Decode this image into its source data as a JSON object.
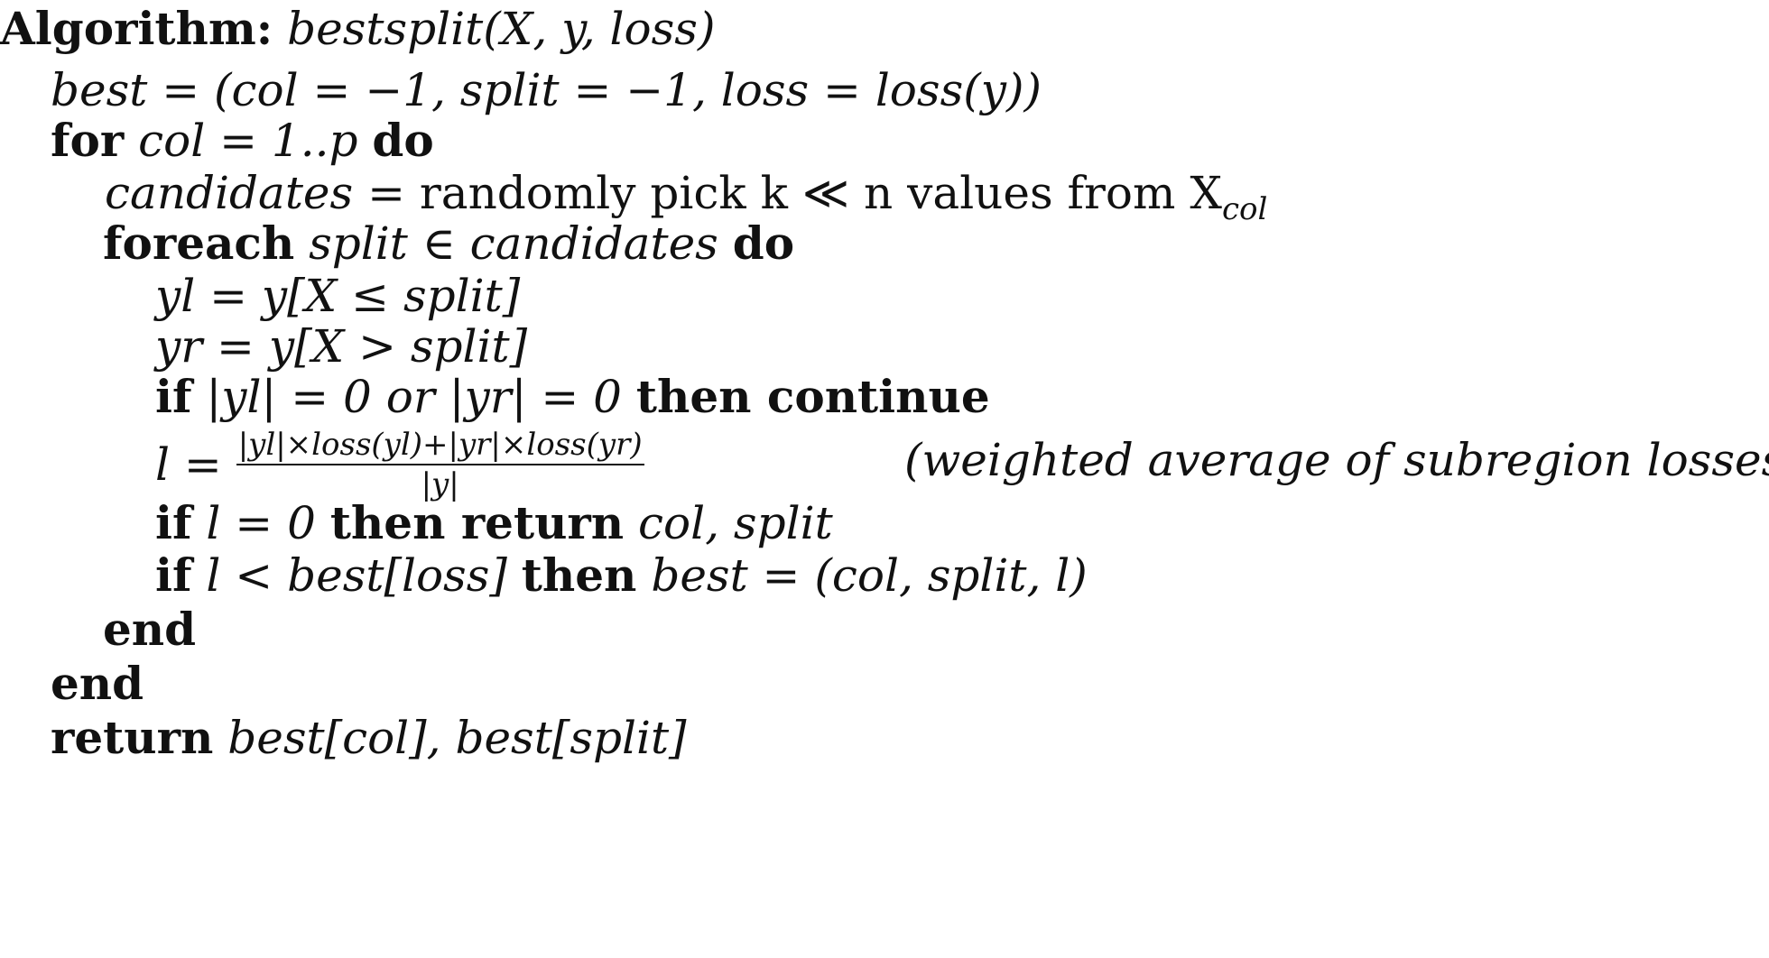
{
  "algorithm": {
    "header_keyword": "Algorithm:",
    "header_signature": "bestsplit(X, y, loss)",
    "lines": {
      "init": "best = (col = −1, split = −1, loss = loss(y))",
      "for_kw": "for",
      "for_expr": "col = 1..p",
      "for_do": "do",
      "candidates_lhs": "candidates",
      "candidates_rhs": " = randomly pick k ≪ n values from X",
      "candidates_sub": "col",
      "foreach_kw": "foreach",
      "foreach_expr": "split ∈ candidates",
      "foreach_do": "do",
      "yl": "yl = y[X ≤ split]",
      "yr": "yr = y[X > split]",
      "if1_kw": "if",
      "if1_expr": "|yl| = 0  or  |yr| = 0",
      "if1_then": "then continue",
      "l_lhs": "l = ",
      "l_numerator": "|yl|×loss(yl)+|yr|×loss(yr)",
      "l_denominator": "|y|",
      "l_comment": "(weighted average of subregion losses)",
      "if2_kw": "if",
      "if2_expr": "l = 0",
      "if2_then": "then return",
      "if2_ret": "col, split",
      "if3_kw": "if",
      "if3_expr": "l < best[loss]",
      "if3_then": "then",
      "if3_assign": "best = (col, split, l)",
      "end_inner": "end",
      "end_outer": "end",
      "return_kw": "return",
      "return_expr": "best[col], best[split]"
    }
  }
}
